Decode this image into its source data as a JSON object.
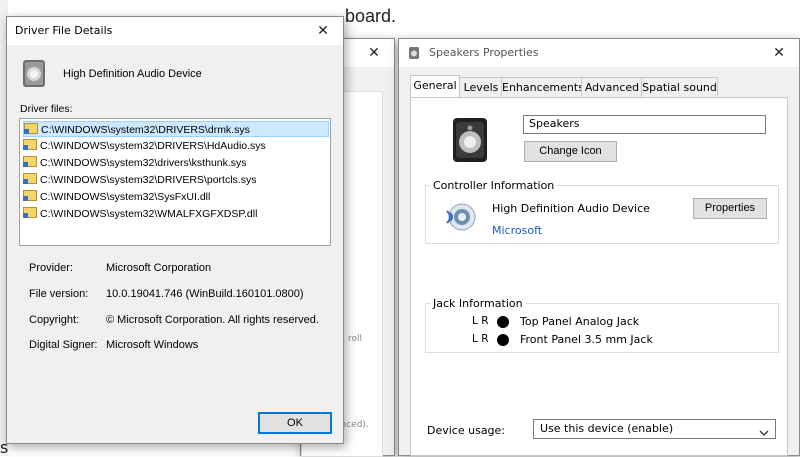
{
  "background": {
    "heading_fragment": "board.",
    "hint_text": "roll",
    "hint_text2": "anced).",
    "corner_char": "s"
  },
  "driver_dialog": {
    "title": "Driver File Details",
    "close_glyph": "✕",
    "device_name": "High Definition Audio Device",
    "driver_files_label": "Driver files:",
    "files": [
      "C:\\WINDOWS\\system32\\DRIVERS\\drmk.sys",
      "C:\\WINDOWS\\system32\\DRIVERS\\HdAudio.sys",
      "C:\\WINDOWS\\system32\\drivers\\ksthunk.sys",
      "C:\\WINDOWS\\system32\\DRIVERS\\portcls.sys",
      "C:\\WINDOWS\\system32\\SysFxUI.dll",
      "C:\\WINDOWS\\system32\\WMALFXGFXDSP.dll"
    ],
    "selected_index": 0,
    "provider_label": "Provider:",
    "provider_value": "Microsoft Corporation",
    "file_version_label": "File version:",
    "file_version_value": "10.0.19041.746 (WinBuild.160101.0800)",
    "copyright_label": "Copyright:",
    "copyright_value": "© Microsoft Corporation. All rights reserved.",
    "signer_label": "Digital Signer:",
    "signer_value": "Microsoft Windows",
    "ok_label": "OK"
  },
  "middle_window": {
    "close_glyph": "✕"
  },
  "speakers_dialog": {
    "title": "Speakers Properties",
    "close_glyph": "✕",
    "tabs": [
      "General",
      "Levels",
      "Enhancements",
      "Advanced",
      "Spatial sound"
    ],
    "active_tab": "General",
    "name_value": "Speakers",
    "change_icon_label": "Change Icon",
    "controller_group_title": "Controller Information",
    "controller_name": "High Definition Audio Device",
    "controller_vendor": "Microsoft",
    "properties_label": "Properties",
    "jack_group_title": "Jack Information",
    "jacks": [
      {
        "channels": "L R",
        "name": "Top Panel Analog Jack"
      },
      {
        "channels": "L R",
        "name": "Front Panel 3.5 mm Jack"
      }
    ],
    "device_usage_label": "Device usage:",
    "device_usage_value": "Use this device (enable)"
  },
  "icons": {
    "speaker": "speaker-icon",
    "file": "file-icon",
    "audio_device": "audio-device-icon",
    "chevron": "chevron-down-icon",
    "jack": "jack-dot-icon"
  }
}
